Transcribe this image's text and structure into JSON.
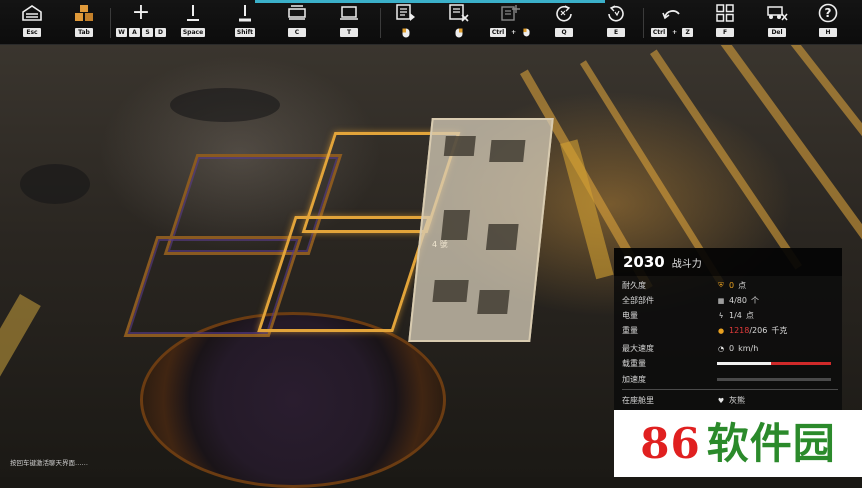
{
  "toolbar": {
    "tools": [
      {
        "name": "garage",
        "icon": "garage-icon",
        "keys": [
          "Esc"
        ]
      },
      {
        "name": "parts",
        "icon": "boxes-icon",
        "keys": [
          "Tab"
        ]
      },
      {
        "name": "move",
        "icon": "move-plus-icon",
        "keys": [
          "W",
          "A",
          "S",
          "D"
        ]
      },
      {
        "name": "raise",
        "icon": "raise-icon",
        "keys": [
          "Space"
        ]
      },
      {
        "name": "lower",
        "icon": "lower-icon",
        "keys": [
          "Shift"
        ]
      },
      {
        "name": "camera-c",
        "icon": "camera-c-icon",
        "keys": [
          "C"
        ]
      },
      {
        "name": "camera-t",
        "icon": "camera-t-icon",
        "keys": [
          "T"
        ]
      },
      {
        "name": "place",
        "icon": "place-part-icon",
        "keys": [
          "mouse-left"
        ]
      },
      {
        "name": "remove",
        "icon": "remove-part-icon",
        "keys": [
          "mouse-right"
        ]
      },
      {
        "name": "multi-place",
        "icon": "multi-place-icon",
        "keys": [
          "Ctrl",
          "+",
          "mouse-left"
        ]
      },
      {
        "name": "rotate-q",
        "icon": "rotate-left-icon",
        "keys": [
          "Q"
        ]
      },
      {
        "name": "rotate-e",
        "icon": "rotate-right-icon",
        "keys": [
          "E"
        ]
      },
      {
        "name": "undo",
        "icon": "undo-icon",
        "keys": [
          "Ctrl",
          "+",
          "Z"
        ]
      },
      {
        "name": "grid",
        "icon": "grid-icon",
        "keys": [
          "F"
        ]
      },
      {
        "name": "delete-vehicle",
        "icon": "delete-vehicle-icon",
        "keys": [
          "Del"
        ]
      },
      {
        "name": "help",
        "icon": "help-icon",
        "keys": [
          "H"
        ]
      }
    ]
  },
  "scene": {
    "part_hint": "4 號"
  },
  "stats": {
    "power_value": "2030",
    "power_label": "战斗力",
    "rows": [
      {
        "label": "耐久度",
        "icon": "shield-icon",
        "value": "0",
        "unit": "点",
        "value_color": "#e8a020"
      },
      {
        "label": "全部部件",
        "icon": "parts-count-icon",
        "value": "4/80",
        "unit": "个"
      },
      {
        "label": "电量",
        "icon": "lightning-icon",
        "value": "1/4",
        "unit": "点"
      },
      {
        "label": "重量",
        "icon": "weight-icon",
        "value_over": "1218",
        "value_rest": "/206",
        "unit": "千克",
        "over_color": "#e23b3b"
      },
      {
        "label": "最大速度",
        "icon": "speedometer-icon",
        "value": "0",
        "unit": "km/h"
      },
      {
        "label": "载重量",
        "bar_white": 0.47,
        "bar_red_start": 0.47,
        "bar_red": 0.53
      },
      {
        "label": "加速度",
        "bar_white": 0.0,
        "bar_red": 0.0
      },
      {
        "label": "在座舱里",
        "icon": "heart-icon",
        "value": "灰熊",
        "unit": ""
      }
    ]
  },
  "status_text": "按回车键激活聊天界面……",
  "watermark": {
    "digits": "86",
    "chars": "软件园",
    "digits_color": "#e02020",
    "chars_color": "#2b8a2b"
  }
}
